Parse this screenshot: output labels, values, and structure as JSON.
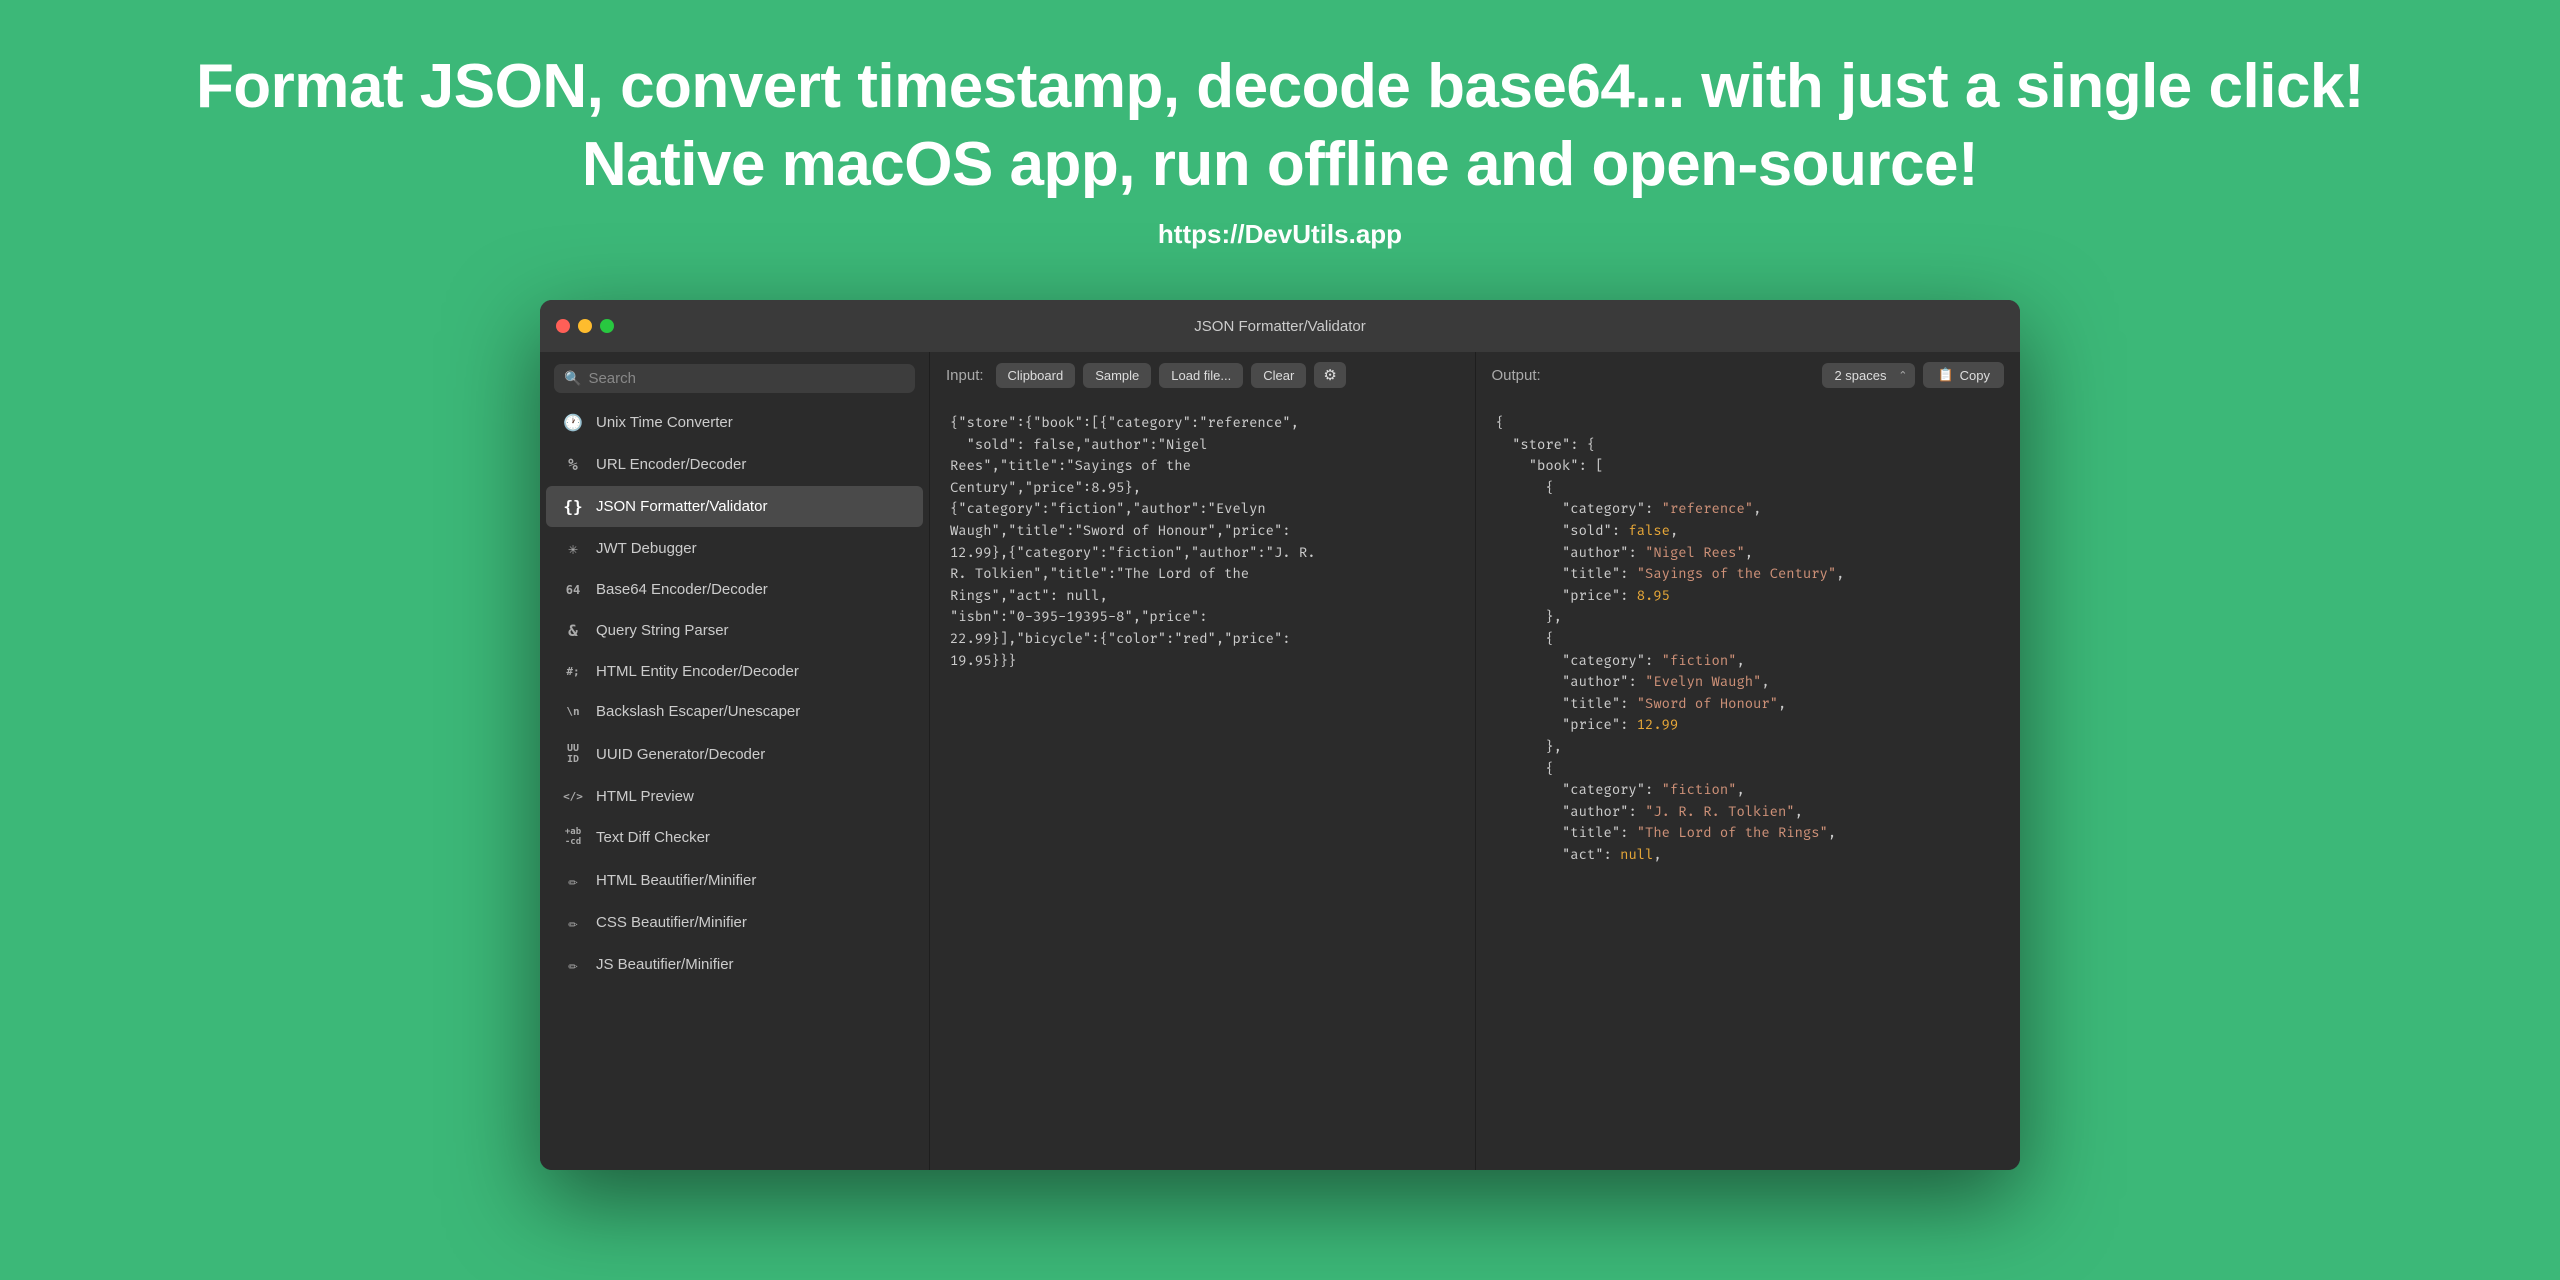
{
  "hero": {
    "line1": "Format JSON, convert timestamp, decode base64... with just a single click!",
    "line2": "Native macOS app, run offline and open-source!",
    "url": "https://DevUtils.app"
  },
  "window": {
    "title": "JSON Formatter/Validator",
    "traffic_lights": [
      "red",
      "yellow",
      "green"
    ]
  },
  "sidebar": {
    "search_placeholder": "Search",
    "items": [
      {
        "id": "unix-time",
        "icon": "🕐",
        "label": "Unix Time Converter",
        "active": false
      },
      {
        "id": "url-encoder",
        "icon": "%",
        "label": "URL Encoder/Decoder",
        "active": false
      },
      {
        "id": "json-formatter",
        "icon": "{}",
        "label": "JSON Formatter/Validator",
        "active": true
      },
      {
        "id": "jwt-debugger",
        "icon": "✳",
        "label": "JWT Debugger",
        "active": false
      },
      {
        "id": "base64",
        "icon": "64",
        "label": "Base64 Encoder/Decoder",
        "active": false
      },
      {
        "id": "query-string",
        "icon": "&",
        "label": "Query String Parser",
        "active": false
      },
      {
        "id": "html-entity",
        "icon": "#;",
        "label": "HTML Entity Encoder/Decoder",
        "active": false
      },
      {
        "id": "backslash",
        "icon": "\\n",
        "label": "Backslash Escaper/Unescaper",
        "active": false
      },
      {
        "id": "uuid",
        "icon": "UU\nID",
        "label": "UUID Generator/Decoder",
        "active": false
      },
      {
        "id": "html-preview",
        "icon": "</>",
        "label": "HTML Preview",
        "active": false
      },
      {
        "id": "text-diff",
        "icon": "+ab\n-cd",
        "label": "Text Diff Checker",
        "active": false
      },
      {
        "id": "html-beautifier",
        "icon": "✏",
        "label": "HTML Beautifier/Minifier",
        "active": false
      },
      {
        "id": "css-beautifier",
        "icon": "✏",
        "label": "CSS Beautifier/Minifier",
        "active": false
      },
      {
        "id": "js-beautifier",
        "icon": "✏",
        "label": "JS Beautifier/Minifier",
        "active": false
      }
    ]
  },
  "input_panel": {
    "label": "Input:",
    "buttons": {
      "clipboard": "Clipboard",
      "sample": "Sample",
      "load_file": "Load file...",
      "clear": "Clear",
      "gear": "⚙"
    },
    "content": "{\"store\":{\"book\":[{\"category\":\"reference\",\n  \"sold\": false,\"author\":\"Nigel\nRees\",\"title\":\"Sayings of the\nCentury\",\"price\":8.95},\n{\"category\":\"fiction\",\"author\":\"Evelyn\nWaugh\",\"title\":\"Sword of Honour\",\"price\":\n12.99},{\"category\":\"fiction\",\"author\":\"J. R.\nR. Tolkien\",\"title\":\"The Lord of the\nRings\",\"act\": null,\n\"isbn\":\"0-395-19395-8\",\"price\":\n22.99}],\"bicycle\":{\"color\":\"red\",\"price\":\n19.95}}}"
  },
  "output_panel": {
    "label": "Output:",
    "spaces_label": "2 spaces",
    "copy_label": "Copy"
  }
}
